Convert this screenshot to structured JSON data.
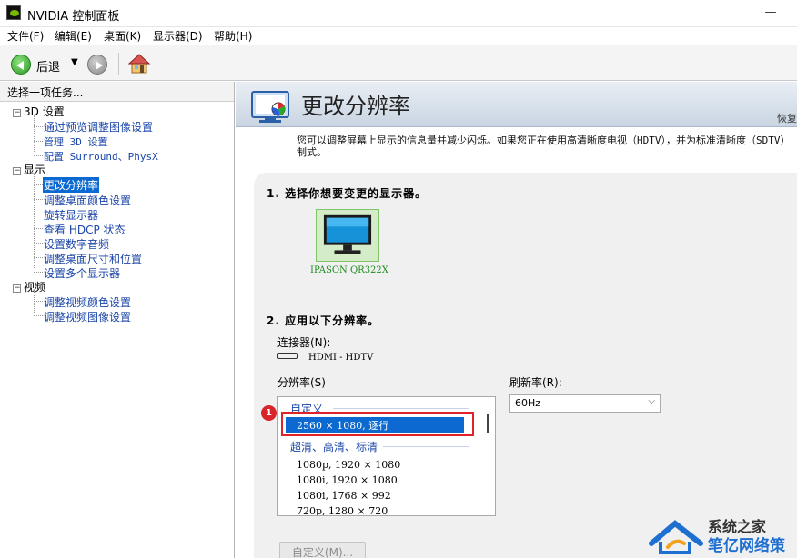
{
  "window": {
    "title": "NVIDIA 控制面板",
    "minimize_glyph": "—"
  },
  "menu": [
    "文件(F)",
    "编辑(E)",
    "桌面(K)",
    "显示器(D)",
    "帮助(H)"
  ],
  "toolbar": {
    "back_label": "后退",
    "dropdown_glyph": "▼"
  },
  "left": {
    "header": "选择一项任务...",
    "tree": {
      "3d": {
        "label": "3D 设置",
        "items": [
          "通过预览调整图像设置",
          "管理 3D 设置",
          "配置 Surround、PhysX"
        ]
      },
      "display": {
        "label": "显示",
        "items": [
          "更改分辨率",
          "调整桌面颜色设置",
          "旋转显示器",
          "查看 HDCP 状态",
          "设置数字音频",
          "调整桌面尺寸和位置",
          "设置多个显示器"
        ]
      },
      "video": {
        "label": "视频",
        "items": [
          "调整视频颜色设置",
          "调整视频图像设置"
        ]
      }
    },
    "expander_glyph": "−"
  },
  "right": {
    "title": "更改分辨率",
    "restore": "恢复",
    "description": "您可以调整屏幕上显示的信息量并减少闪烁。如果您正在使用高清晰度电视（HDTV），并为标准清晰度（SDTV）制式。",
    "step1": "1. 选择你想要变更的显示器。",
    "display_name": "IPASON QR322X",
    "step2": "2. 应用以下分辨率。",
    "connector_label": "连接器(N):",
    "connector_value": "HDMI - HDTV",
    "resolution_label": "分辨率(S)",
    "refresh_label": "刷新率(R):",
    "refresh_value": "60Hz",
    "select_caret": "⌵",
    "list": {
      "group_custom": "自定义",
      "selected": "2560 × 1080, 逐行",
      "group_hd": "超清、高清、标清",
      "rows": [
        "1080p, 1920 × 1080",
        "1080i, 1920 × 1080",
        "1080i, 1768 × 992",
        "720p, 1280 × 720"
      ]
    },
    "badge": "1",
    "custom_button": "自定义(M)..."
  },
  "watermark": {
    "line1": "系统之家",
    "line2": "笔亿网络策划"
  },
  "colors": {
    "selection": "#0b69d1",
    "highlight_box": "#e0222a",
    "nvidia_green": "#76b900",
    "link_blue": "#1b46a8"
  }
}
